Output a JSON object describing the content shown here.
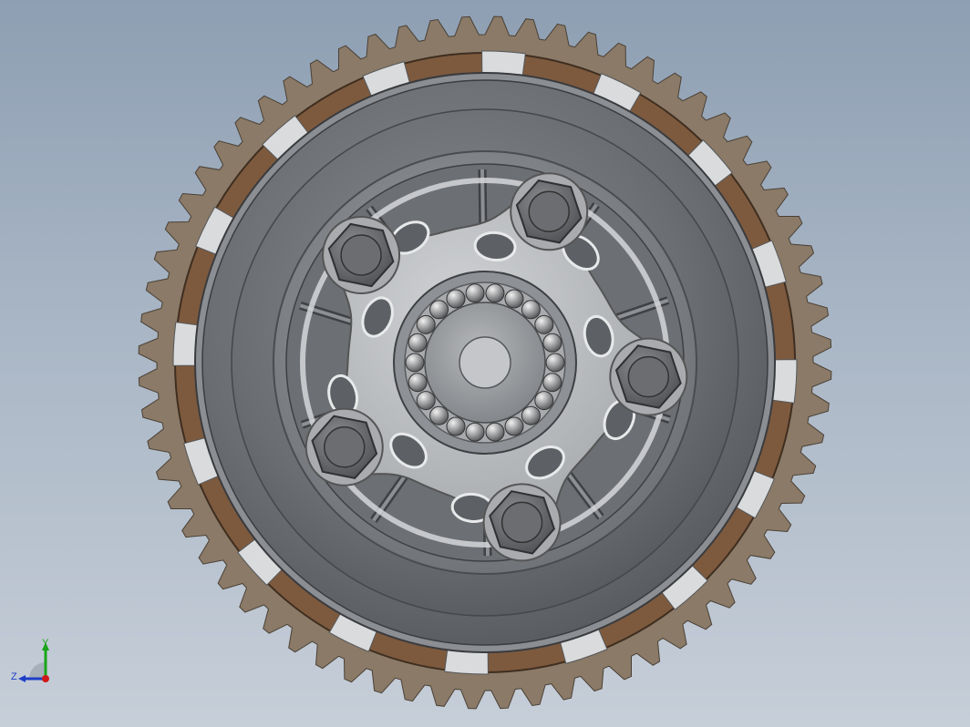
{
  "viewport": {
    "background_top": "#8e9fb3",
    "background_bottom": "#c6ced8"
  },
  "model": {
    "parts": [
      "ring-gear",
      "friction-plates",
      "clutch-basket",
      "pressure-plate",
      "spring-bolts",
      "release-bearing"
    ],
    "gear_teeth": 68,
    "friction_segments": 16,
    "spring_bolts": 5,
    "bearing_balls": 22,
    "colors": {
      "gear": "#8a7a67",
      "friction": "#7d5a3e",
      "basket": "#6f7276",
      "pressure_plate": "#b7b9bc",
      "bolt": "#6c6d70"
    }
  },
  "triad": {
    "y_label": "Y",
    "z_label": "Z",
    "y_color": "#18a418",
    "z_color": "#1e3ec8",
    "x_color": "#d01818"
  }
}
